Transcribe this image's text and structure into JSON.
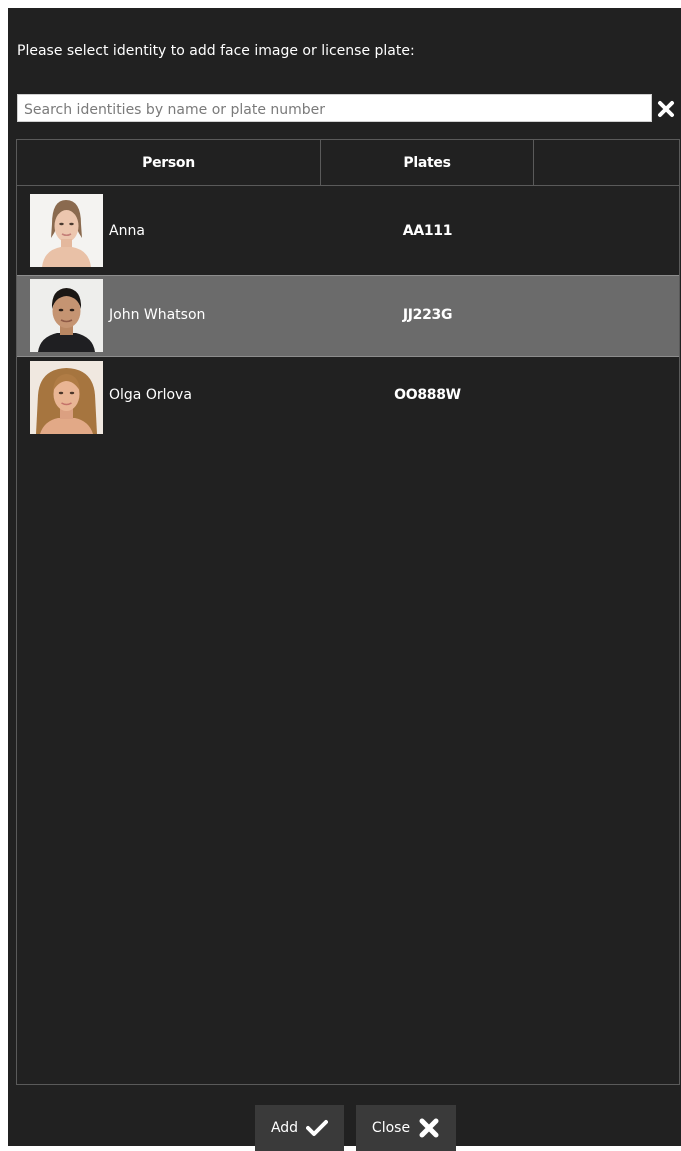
{
  "dialog": {
    "prompt": "Please select identity to add face image or license plate:"
  },
  "search": {
    "placeholder": "Search identities by name or plate number",
    "value": "",
    "clear_icon": "close-x-icon"
  },
  "table": {
    "columns": [
      "Person",
      "Plates",
      ""
    ],
    "rows": [
      {
        "name": "Anna",
        "plate": "AA111",
        "photo_icon": "face-photo-anna",
        "selected": false
      },
      {
        "name": "John Whatson",
        "plate": "JJ223G",
        "photo_icon": "face-photo-john",
        "selected": true
      },
      {
        "name": "Olga Orlova",
        "plate": "OO888W",
        "photo_icon": "face-photo-olga",
        "selected": false
      }
    ]
  },
  "footer": {
    "add_label": "Add",
    "add_icon": "checkmark-icon",
    "close_label": "Close",
    "close_icon": "close-x-icon"
  },
  "colors": {
    "background": "#212121",
    "selected_row": "#6b6b6b",
    "border": "#5a5a5a",
    "button": "#3a3a3a",
    "text": "#ffffff"
  }
}
